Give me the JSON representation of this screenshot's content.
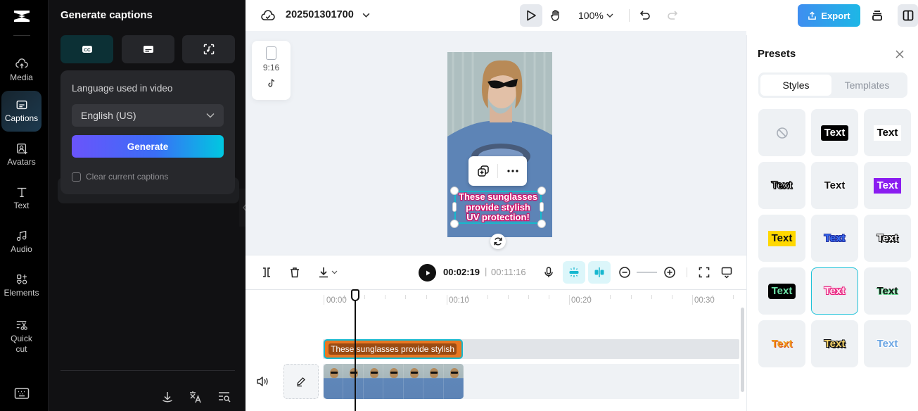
{
  "rail": {
    "items": [
      {
        "label": "Media",
        "icon": "cloud-upload-icon"
      },
      {
        "label": "Captions",
        "icon": "captions-icon",
        "active": true
      },
      {
        "label": "Avatars",
        "icon": "avatar-icon"
      },
      {
        "label": "Text",
        "icon": "text-icon"
      },
      {
        "label": "Audio",
        "icon": "music-note-icon"
      },
      {
        "label": "Elements",
        "icon": "elements-icon"
      },
      {
        "label": "Quick cut",
        "icon": "quick-cut-icon"
      }
    ]
  },
  "panel": {
    "title": "Generate captions",
    "modes": [
      "auto-captions",
      "manual-captions",
      "lyrics-captions"
    ],
    "language_label": "Language used in video",
    "language_value": "English (US)",
    "generate_label": "Generate",
    "clear_label": "Clear current captions",
    "clear_checked": false
  },
  "topbar": {
    "project_name": "202501301700",
    "zoom": "100%",
    "export_label": "Export"
  },
  "canvas": {
    "ratio": "9:16",
    "platform": "TikTok",
    "caption_lines": [
      "These sunglasses",
      "provide stylish",
      "UV protection!"
    ]
  },
  "playback": {
    "current": "00:02:19",
    "separator": "|",
    "total": "00:11:16"
  },
  "timeline": {
    "ruler": [
      "00:00",
      "00:10",
      "00:20",
      "00:30"
    ],
    "caption_clip": "These sunglasses provide stylish"
  },
  "presets": {
    "title": "Presets",
    "tabs": [
      "Styles",
      "Templates"
    ],
    "active_tab": "Styles",
    "tiles": [
      {
        "label": "",
        "style": "none"
      },
      {
        "label": "Text",
        "style": "white-on-black"
      },
      {
        "label": "Text",
        "style": "black-on-white"
      },
      {
        "label": "Text",
        "style": "white-outline-black"
      },
      {
        "label": "Text",
        "style": "black-outline-white"
      },
      {
        "label": "Text",
        "style": "white-on-purple"
      },
      {
        "label": "Text",
        "style": "black-on-yellow"
      },
      {
        "label": "Text",
        "style": "blue-outline"
      },
      {
        "label": "Text",
        "style": "black-white-outline"
      },
      {
        "label": "Text",
        "style": "green-on-black"
      },
      {
        "label": "Text",
        "style": "pink-outline",
        "selected": true
      },
      {
        "label": "Text",
        "style": "black-green-glow"
      },
      {
        "label": "Text",
        "style": "orange-gradient"
      },
      {
        "label": "Text",
        "style": "yellow-black-outline"
      },
      {
        "label": "Text",
        "style": "blue-white-outline"
      }
    ]
  },
  "colors": {
    "accent": "#13b9d0",
    "export": "#3f8ef0",
    "caption_stroke": "#d0116a",
    "clip": "#e87722"
  }
}
